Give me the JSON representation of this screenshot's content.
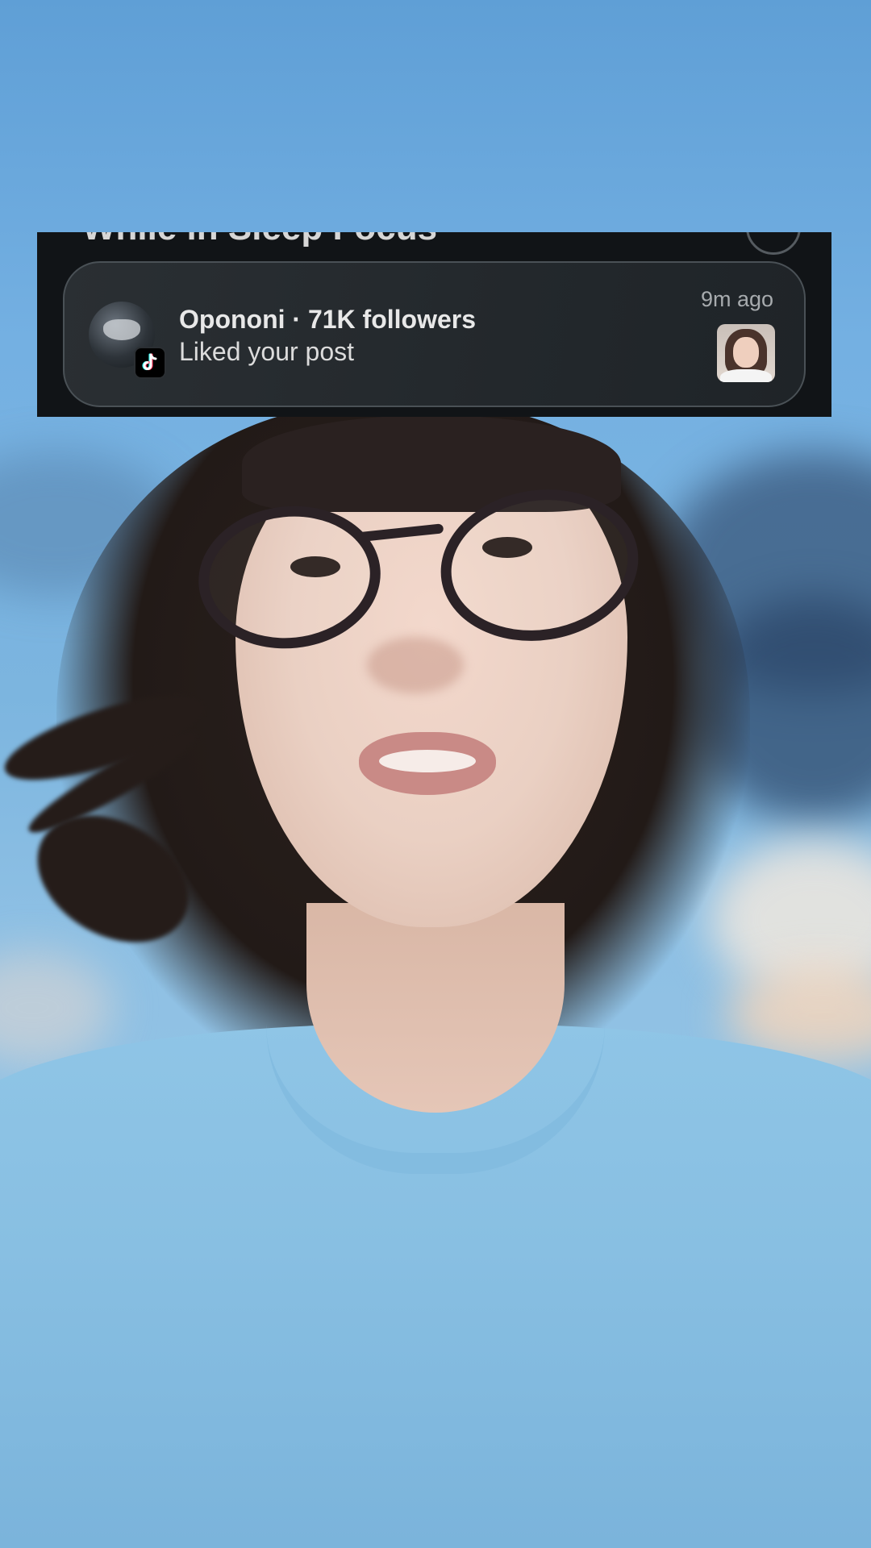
{
  "notification": {
    "partial_header": "While in Sleep Focus",
    "sender": "Opononi · 71K followers",
    "message": "Liked your post",
    "time": "9m ago",
    "app_icon": "tiktok-icon"
  }
}
